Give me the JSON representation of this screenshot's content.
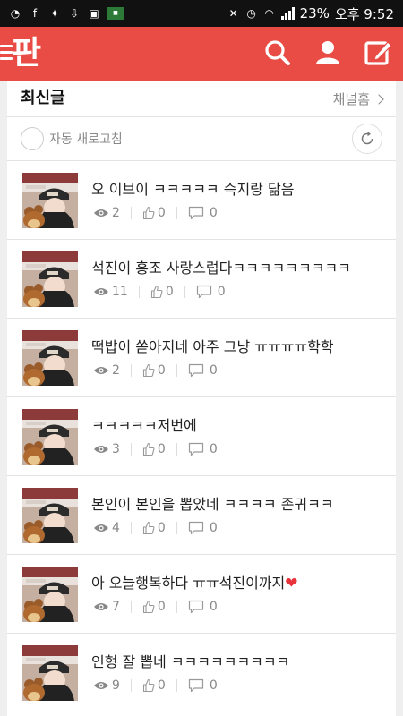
{
  "statusbar": {
    "battery": "23%",
    "time": "오후 9:52"
  },
  "header": {
    "logo": "판"
  },
  "section": {
    "title": "최신글",
    "channel_home": "채널홈"
  },
  "refresh": {
    "label": "자동 새로고침"
  },
  "posts": [
    {
      "title": "오 이브이 ㅋㅋㅋㅋㅋ 슥지랑 닮음",
      "views": "2",
      "likes": "0",
      "comments": "0"
    },
    {
      "title": "석진이 홍조 사랑스럽다ㅋㅋㅋㅋㅋㅋㅋㅋㅋ",
      "views": "11",
      "likes": "0",
      "comments": "0"
    },
    {
      "title": "떡밥이 쏟아지네 아주 그냥 ㅠㅠㅠㅠ학학",
      "views": "2",
      "likes": "0",
      "comments": "0"
    },
    {
      "title": "ㅋㅋㅋㅋㅋ저번에",
      "views": "3",
      "likes": "0",
      "comments": "0"
    },
    {
      "title": "본인이 본인을 뽑았네 ㅋㅋㅋㅋ 존귀ㅋㅋ",
      "views": "4",
      "likes": "0",
      "comments": "0"
    },
    {
      "title": "아 오늘행복하다 ㅠㅠ석진이까지",
      "views": "7",
      "likes": "0",
      "comments": "0"
    },
    {
      "title": "인형 잘 뽑네 ㅋㅋㅋㅋㅋㅋㅋㅋㅋ",
      "views": "9",
      "likes": "0",
      "comments": "0"
    }
  ],
  "colors": {
    "brand": "#e84c44",
    "heart": "#e8333a"
  }
}
